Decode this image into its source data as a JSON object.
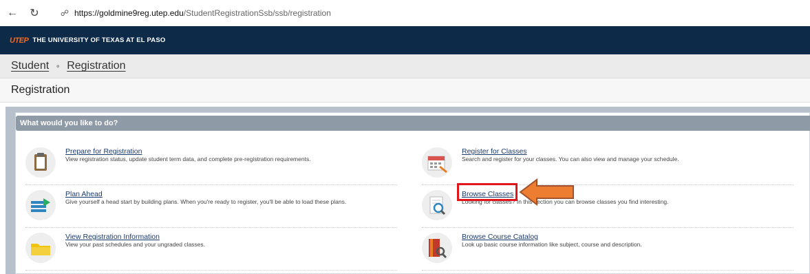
{
  "browser": {
    "back_icon": "arrow-left-icon",
    "reload_icon": "reload-icon",
    "url_host": "https://goldmine9reg.utep.edu",
    "url_path": "/StudentRegistrationSsb/ssb/registration"
  },
  "banner": {
    "logo_text": "UTEP",
    "university_name": "THE UNIVERSITY OF TEXAS AT EL PASO"
  },
  "breadcrumb": {
    "items": [
      "Student",
      "Registration"
    ]
  },
  "page_title": "Registration",
  "panel": {
    "header": "What would you like to do?",
    "items": [
      {
        "title": "Prepare for Registration",
        "desc": "View registration status, update student term data, and complete pre-registration requirements.",
        "icon": "clipboard-icon"
      },
      {
        "title": "Register for Classes",
        "desc": "Search and register for your classes. You can also view and manage your schedule.",
        "icon": "calendar-icon"
      },
      {
        "title": "Plan Ahead",
        "desc": "Give yourself a head start by building plans. When you're ready to register, you'll be able to load these plans.",
        "icon": "plan-icon"
      },
      {
        "title": "Browse Classes",
        "desc": "Looking for classes? In this section you can browse classes you find interesting.",
        "icon": "magnifier-document-icon"
      },
      {
        "title": "View Registration Information",
        "desc": "View your past schedules and your ungraded classes.",
        "icon": "folder-icon"
      },
      {
        "title": "Browse Course Catalog",
        "desc": "Look up basic course information like subject, course and description.",
        "icon": "catalog-icon"
      }
    ]
  },
  "annotation": {
    "highlight_color": "#e0161b",
    "arrow_color": "#ed7d31"
  }
}
